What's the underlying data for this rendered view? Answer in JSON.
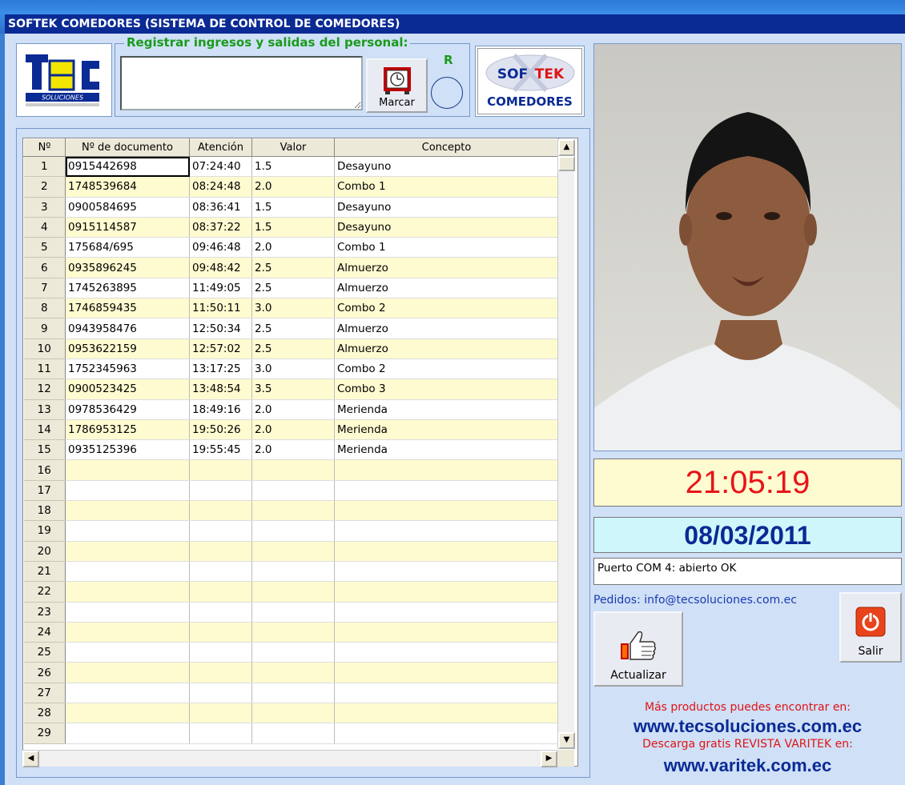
{
  "window": {
    "title": "SOFTEK COMEDORES (SISTEMA DE CONTROL DE COMEDORES)"
  },
  "colors": {
    "accent_green": "#1a9b1a",
    "title_blue": "#0a2a94",
    "clock_red": "#e8141a",
    "row_yellow": "#fffbd0"
  },
  "logos": {
    "tec": "T C SOLUCIONES",
    "softek": "SOF TEK",
    "softek_sub": "COMEDORES"
  },
  "register": {
    "legend": "Registrar ingresos y salidas del personal:",
    "input_value": "",
    "marcar_label": "Marcar",
    "r_label": "R"
  },
  "grid": {
    "headers": [
      "Nº",
      "Nº de documento",
      "Atención",
      "Valor",
      "Concepto"
    ],
    "rows": [
      [
        "1",
        "0915442698",
        "07:24:40",
        "1.5",
        "Desayuno"
      ],
      [
        "2",
        "1748539684",
        "08:24:48",
        "2.0",
        "Combo 1"
      ],
      [
        "3",
        "0900584695",
        "08:36:41",
        "1.5",
        "Desayuno"
      ],
      [
        "4",
        "0915114587",
        "08:37:22",
        "1.5",
        "Desayuno"
      ],
      [
        "5",
        "175684/695",
        "09:46:48",
        "2.0",
        "Combo 1"
      ],
      [
        "6",
        "0935896245",
        "09:48:42",
        "2.5",
        "Almuerzo"
      ],
      [
        "7",
        "1745263895",
        "11:49:05",
        "2.5",
        "Almuerzo"
      ],
      [
        "8",
        "1746859435",
        "11:50:11",
        "3.0",
        "Combo 2"
      ],
      [
        "9",
        "0943958476",
        "12:50:34",
        "2.5",
        "Almuerzo"
      ],
      [
        "10",
        "0953622159",
        "12:57:02",
        "2.5",
        "Almuerzo"
      ],
      [
        "11",
        "1752345963",
        "13:17:25",
        "3.0",
        "Combo 2"
      ],
      [
        "12",
        "0900523425",
        "13:48:54",
        "3.5",
        "Combo 3"
      ],
      [
        "13",
        "0978536429",
        "18:49:16",
        "2.0",
        "Merienda"
      ],
      [
        "14",
        "1786953125",
        "19:50:26",
        "2.0",
        "Merienda"
      ],
      [
        "15",
        "0935125396",
        "19:55:45",
        "2.0",
        "Merienda"
      ],
      [
        "16",
        "",
        "",
        "",
        ""
      ],
      [
        "17",
        "",
        "",
        "",
        ""
      ],
      [
        "18",
        "",
        "",
        "",
        ""
      ],
      [
        "19",
        "",
        "",
        "",
        ""
      ],
      [
        "20",
        "",
        "",
        "",
        ""
      ],
      [
        "21",
        "",
        "",
        "",
        ""
      ],
      [
        "22",
        "",
        "",
        "",
        ""
      ],
      [
        "23",
        "",
        "",
        "",
        ""
      ],
      [
        "24",
        "",
        "",
        "",
        ""
      ],
      [
        "25",
        "",
        "",
        "",
        ""
      ],
      [
        "26",
        "",
        "",
        "",
        ""
      ],
      [
        "27",
        "",
        "",
        "",
        ""
      ],
      [
        "28",
        "",
        "",
        "",
        ""
      ],
      [
        "29",
        "",
        "",
        "",
        ""
      ]
    ]
  },
  "clock": {
    "time": "21:05:19",
    "date": "08/03/2011"
  },
  "status": {
    "text": "Puerto COM 4: abierto OK"
  },
  "actions": {
    "pedidos": "Pedidos: info@tecsoluciones.com.ec",
    "actualizar_label": "Actualizar",
    "salir_label": "Salir"
  },
  "promo": {
    "line1": "Más productos puedes encontrar en:",
    "url1": "www.tecsoluciones.com.ec",
    "line2": "Descarga gratis REVISTA VARITEK en:",
    "url2": "www.varitek.com.ec"
  },
  "icons": [
    "clock-icon",
    "thumbs-up-icon",
    "power-icon",
    "scroll-up-icon",
    "scroll-down-icon",
    "scroll-left-icon",
    "scroll-right-icon"
  ]
}
